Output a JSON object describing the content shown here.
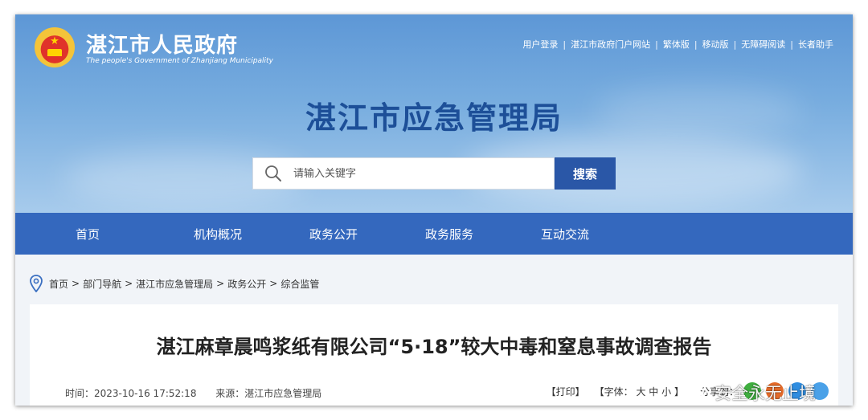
{
  "header": {
    "gov_name": "湛江市人民政府",
    "gov_name_en": "The people's Government of Zhanjiang Municipality",
    "top_links": [
      "用户登录",
      "湛江市政府门户网站",
      "繁体版",
      "移动版",
      "无障碍阅读",
      "长者助手"
    ],
    "bureau_title": "湛江市应急管理局"
  },
  "search": {
    "placeholder": "请输入关键字",
    "button_label": "搜索"
  },
  "nav": {
    "items": [
      "首页",
      "机构概况",
      "政务公开",
      "政务服务",
      "互动交流"
    ]
  },
  "breadcrumb": {
    "items": [
      "首页",
      "部门导航",
      "湛江市应急管理局",
      "政务公开",
      "综合监管"
    ],
    "separator": ">"
  },
  "article": {
    "title": "湛江麻章晨鸣浆纸有限公司“5·18”较大中毒和窒息事故调查报告",
    "time": "时间：2023-10-16 17:52:18",
    "source": "来源：湛江市应急管理局",
    "print_label": "【打印】",
    "font_label": "【字体：",
    "font_large": "大",
    "font_medium": "中",
    "font_small": "小",
    "font_close": "】",
    "share_label": "分享到："
  },
  "watermark": {
    "text": "安全永无止境"
  },
  "colors": {
    "nav_bg": "#3468be",
    "search_button": "#2a57a7",
    "bureau_title": "#1d4f98"
  },
  "icons": {
    "emblem": "national-emblem-icon",
    "search": "magnifier-icon",
    "location": "location-pin-icon",
    "share": [
      "wechat-icon",
      "weibo-icon",
      "qq-icon",
      "qzone-icon"
    ],
    "watermark": "wechat-channel-icon"
  }
}
